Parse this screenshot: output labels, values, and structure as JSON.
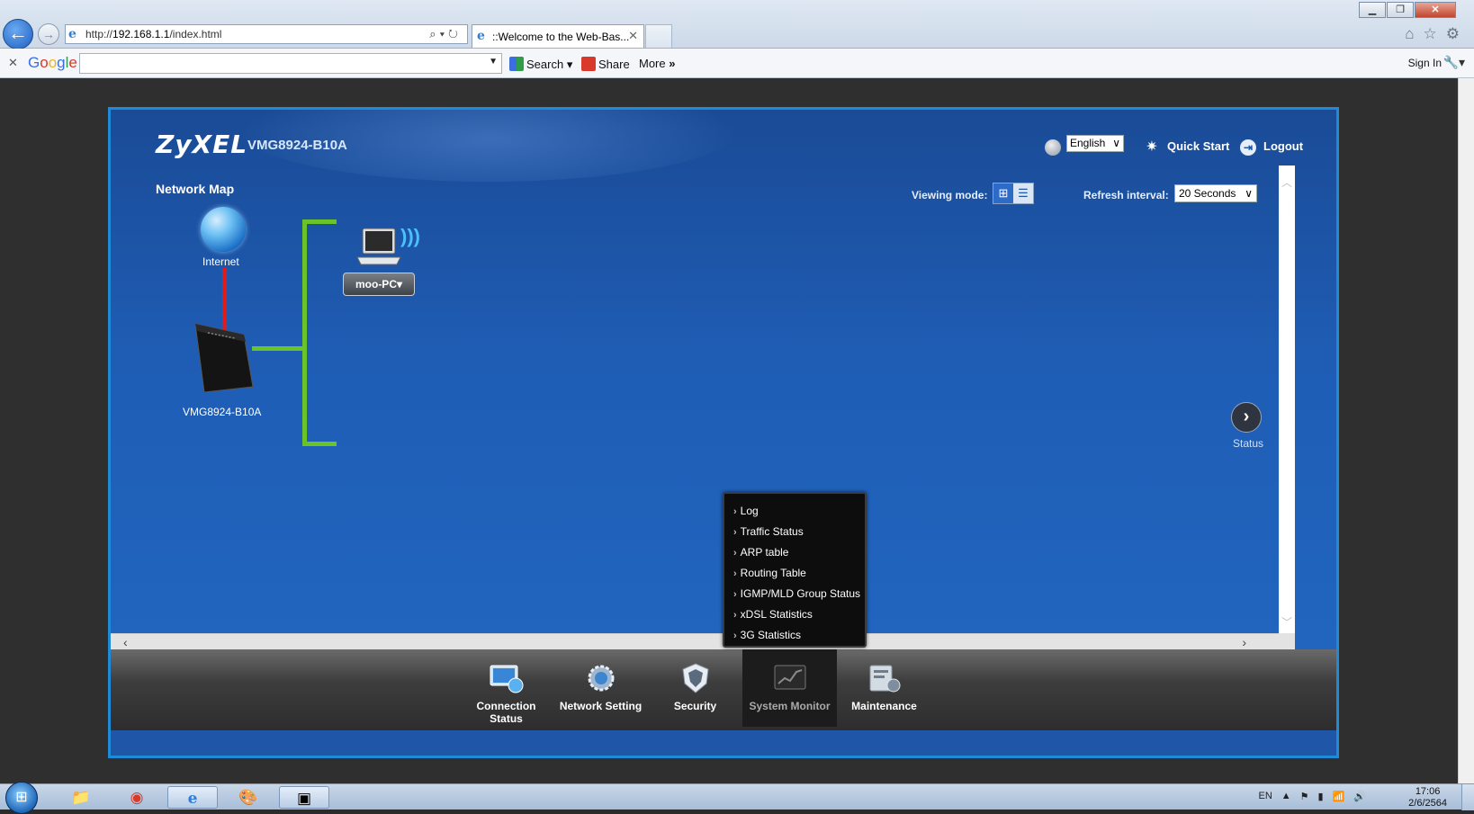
{
  "browser": {
    "url_prefix": "http://",
    "url_host": "192.168.1.1",
    "url_path": "/index.html",
    "tab_title": "::Welcome to the Web-Bas...",
    "google_bar": {
      "logo": "Google",
      "search_label": "Search",
      "share_label": "Share",
      "more_label": "More",
      "signin_label": "Sign In"
    }
  },
  "app": {
    "brand": "ZyXEL",
    "model": "VMG8924-B10A",
    "language": "English",
    "quick_start": "Quick Start",
    "logout": "Logout",
    "page_title": "Network Map",
    "viewing_mode_label": "Viewing mode:",
    "refresh_label": "Refresh interval:",
    "refresh_value": "20 Seconds",
    "status_label": "Status",
    "map": {
      "internet_label": "Internet",
      "router_label": "VMG8924-B10A",
      "client_label": "moo-PC",
      "wan_color": "#e01b1b",
      "lan_color": "#6bc32a"
    },
    "nav": [
      {
        "label": "Connection Status",
        "icon": "monitor-globe-icon",
        "state": "active"
      },
      {
        "label": "Network Setting",
        "icon": "gear-globe-icon",
        "state": ""
      },
      {
        "label": "Security",
        "icon": "shield-icon",
        "state": ""
      },
      {
        "label": "System Monitor",
        "icon": "chart-monitor-icon",
        "state": "hover"
      },
      {
        "label": "Maintenance",
        "icon": "tools-icon",
        "state": ""
      }
    ],
    "system_monitor_menu": [
      "Log",
      "Traffic Status",
      "ARP table",
      "Routing Table",
      "IGMP/MLD Group Status",
      "xDSL Statistics",
      "3G Statistics"
    ]
  },
  "taskbar": {
    "language": "EN",
    "time": "17:06",
    "date": "2/6/2564"
  },
  "colors": {
    "accent": "#1f8ad8",
    "app_background": "#1f56a8"
  }
}
